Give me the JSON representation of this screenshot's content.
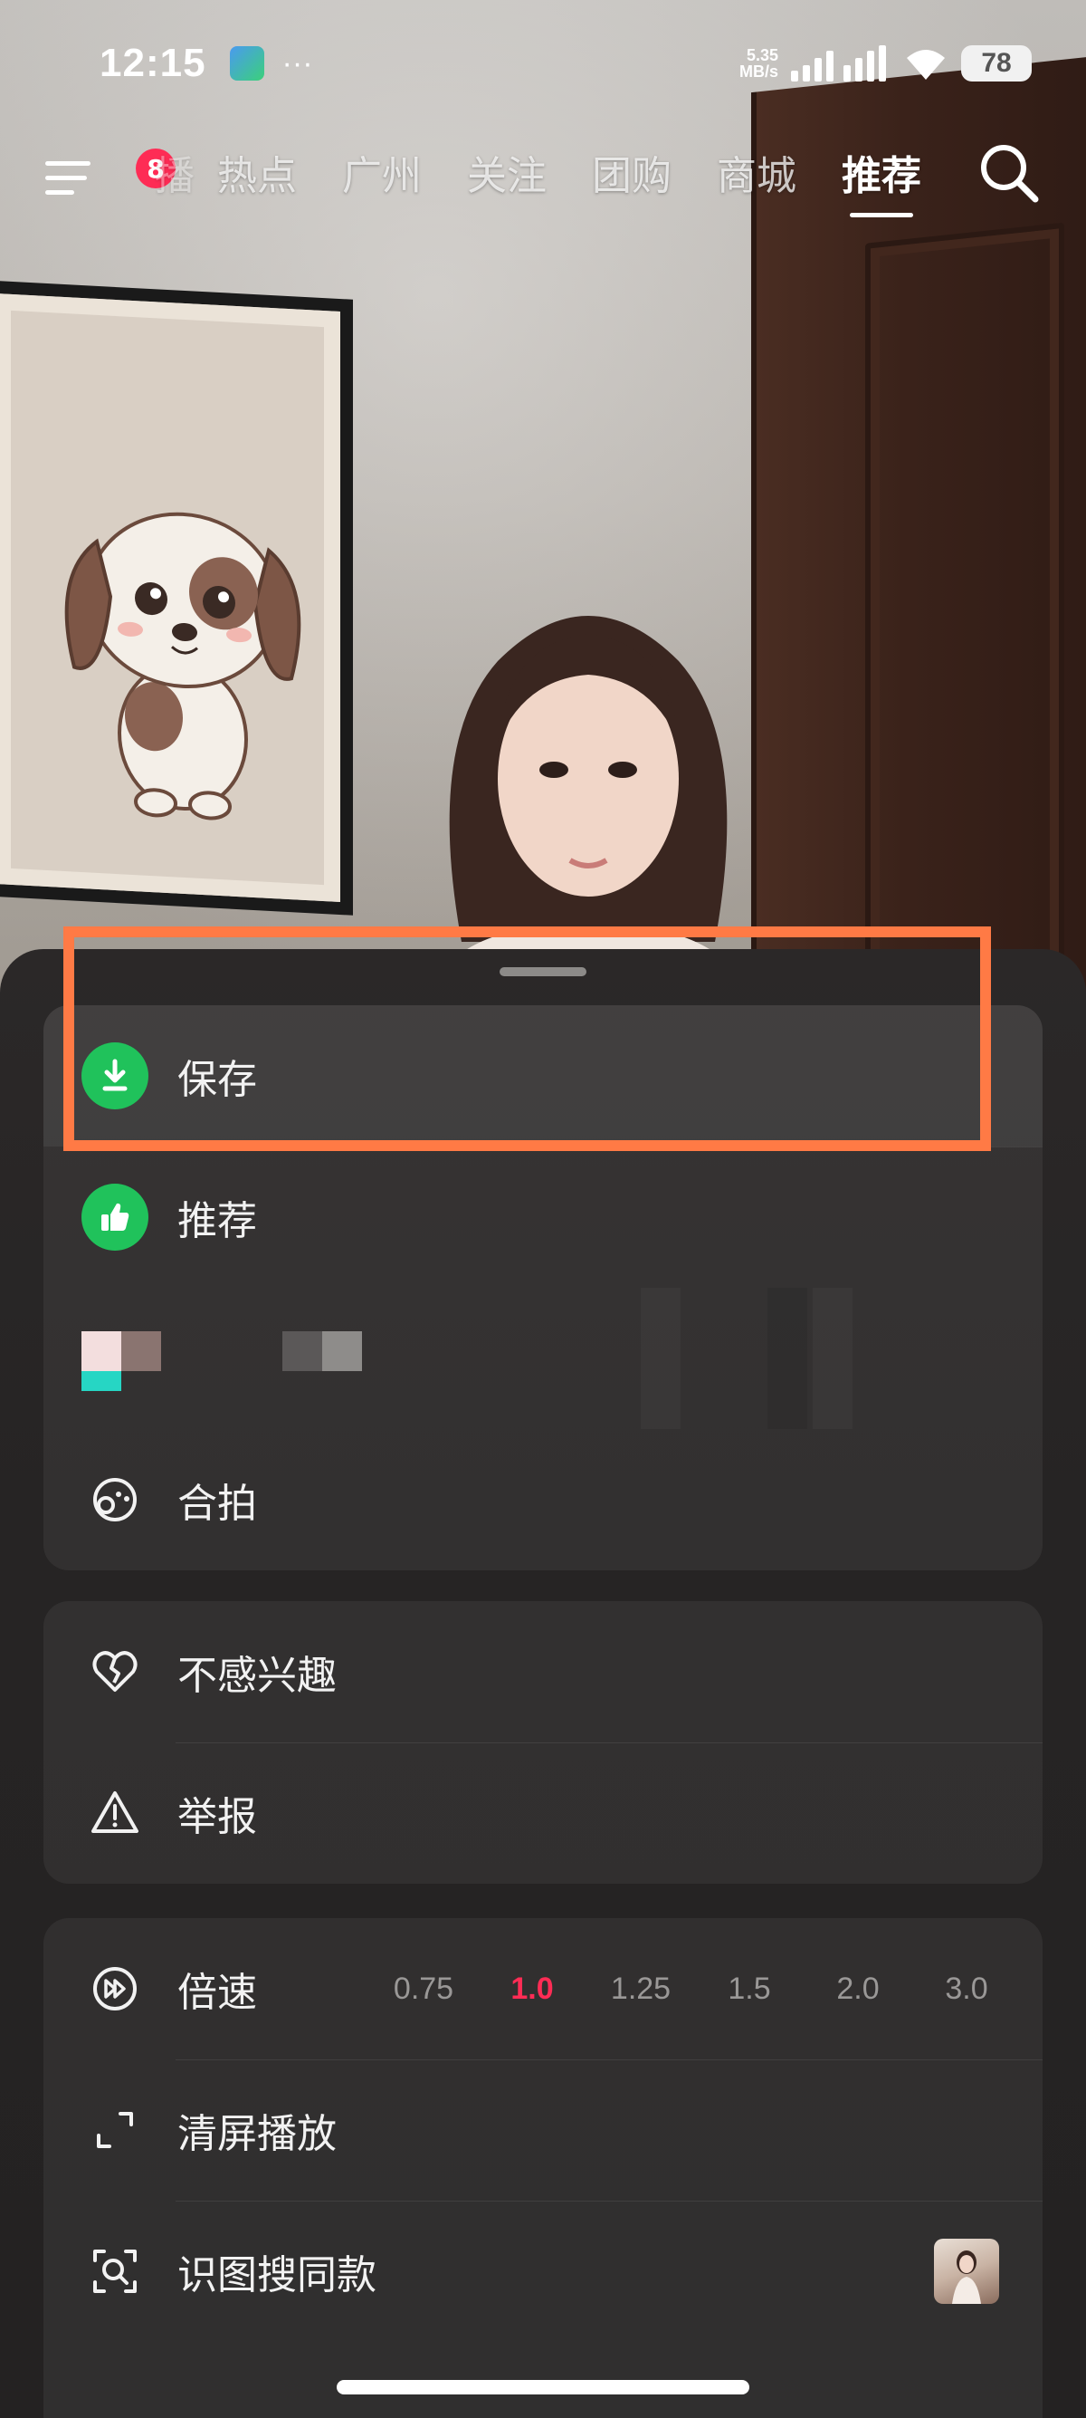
{
  "status_bar": {
    "time": "12:15",
    "more": "···",
    "net_speed_value": "5.35",
    "net_speed_unit": "MB/s",
    "battery": "78"
  },
  "nav": {
    "notification_count": "8",
    "tabs": [
      {
        "label": "播",
        "active": false
      },
      {
        "label": "热点",
        "active": false
      },
      {
        "label": "广州",
        "active": false
      },
      {
        "label": "关注",
        "active": false
      },
      {
        "label": "团购",
        "active": false
      },
      {
        "label": "商城",
        "active": false
      },
      {
        "label": "推荐",
        "active": true
      }
    ]
  },
  "sheet": {
    "group1": [
      {
        "label": "保存",
        "icon": "download-icon"
      },
      {
        "label": "推荐",
        "icon": "thumbs-up-icon"
      },
      {
        "label": "合拍",
        "icon": "duet-icon"
      }
    ],
    "group2": [
      {
        "label": "不感兴趣",
        "icon": "broken-heart-icon"
      },
      {
        "label": "举报",
        "icon": "warning-icon"
      }
    ],
    "group3": {
      "speed_label": "倍速",
      "speed_options": [
        "0.75",
        "1.0",
        "1.25",
        "1.5",
        "2.0",
        "3.0"
      ],
      "speed_selected": "1.0",
      "clear_screen_label": "清屏播放",
      "image_search_label": "识图搜同款"
    }
  },
  "colors": {
    "accent_red": "#fe2c55",
    "action_green": "#20c25b",
    "highlight_orange": "#ff7a45"
  }
}
